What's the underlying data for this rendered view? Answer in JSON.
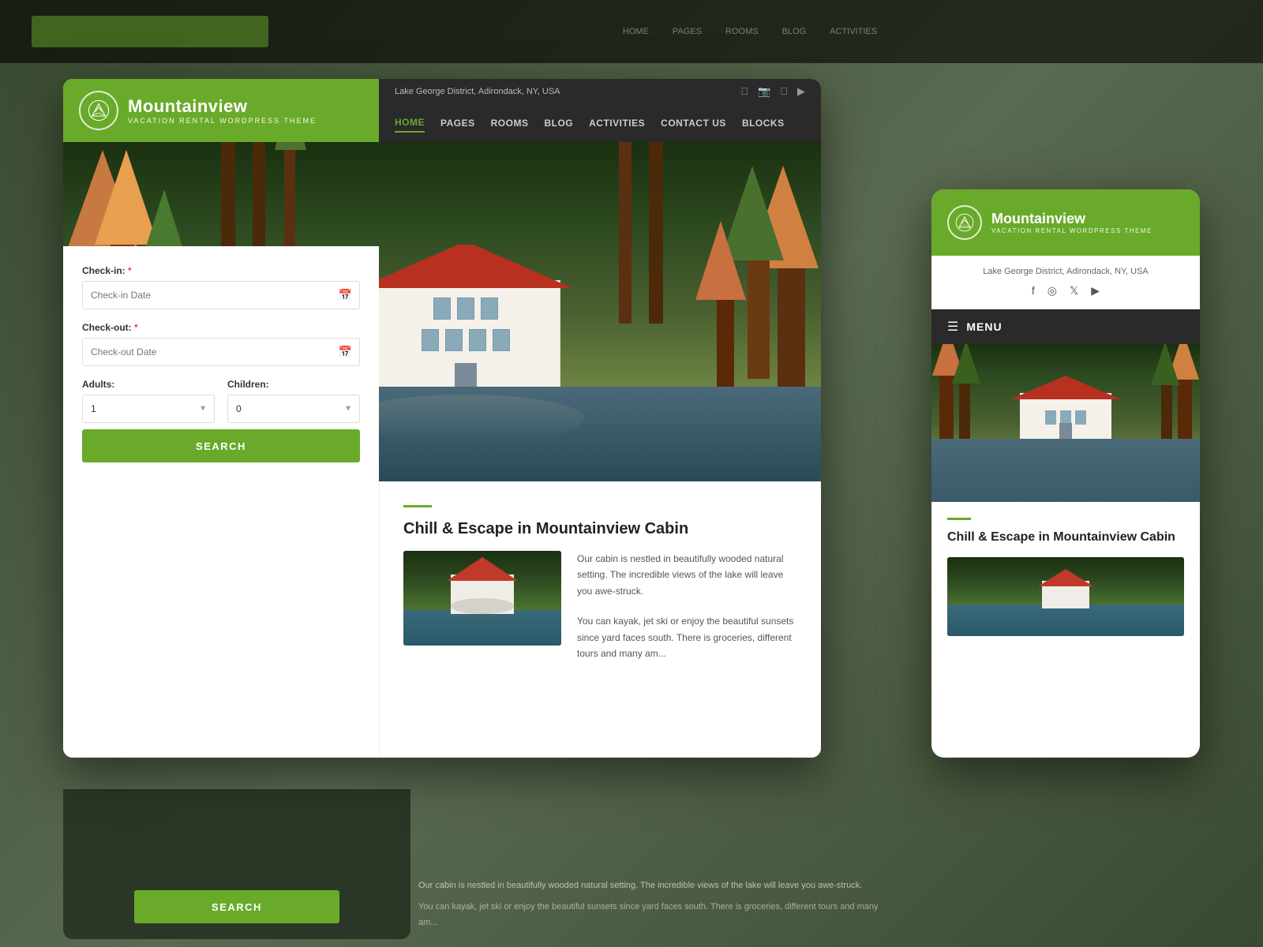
{
  "background": {
    "color": "#4a5a40"
  },
  "desktop_mockup": {
    "header": {
      "logo": {
        "brand_name": "Mountainview",
        "brand_sub": "VACATION RENTAL WORDPRESS THEME"
      },
      "location": "Lake George District, Adirondack, NY, USA",
      "social_icons": [
        "f",
        "instagram",
        "twitter",
        "youtube"
      ],
      "nav_links": [
        "HOME",
        "PAGES",
        "ROOMS",
        "BLOG",
        "ACTIVITIES",
        "CONTACT US",
        "BLOCKS"
      ],
      "active_nav": "HOME"
    },
    "search_form": {
      "checkin_label": "Check-in:",
      "checkin_required": "*",
      "checkin_placeholder": "Check-in Date",
      "checkout_label": "Check-out:",
      "checkout_required": "*",
      "checkout_placeholder": "Check-out Date",
      "adults_label": "Adults:",
      "adults_value": "1",
      "children_label": "Children:",
      "children_value": "0",
      "search_button": "SEARCH"
    },
    "content": {
      "title": "Chill & Escape in Mountainview Cabin",
      "text1": "Our cabin is nestled in beautifully wooded natural setting. The incredible views of the lake will leave you awe-struck.",
      "text2": "You can kayak, jet ski or enjoy the beautiful sunsets since yard faces south. There is groceries, different tours and many am..."
    }
  },
  "mobile_mockup": {
    "header": {
      "brand_name": "Mountainview",
      "brand_sub": "VACATION RENTAL WORDPRESS THEME"
    },
    "location": "Lake George District, Adirondack, NY, USA",
    "social_icons": [
      "f",
      "instagram",
      "twitter",
      "youtube"
    ],
    "menu_label": "MENU",
    "content": {
      "title": "Chill & Escape in Mountainview Cabin"
    }
  },
  "bottom": {
    "search_button": "SEARCH",
    "blur_text1": "Our cabin is nestled in beautifully wooded natural setting. The incredible views of the lake will leave you awe-struck.",
    "blur_text2": "You can kayak, jet ski or enjoy the beautiful sunsets since yard faces south. There is groceries, different tours and many am..."
  }
}
